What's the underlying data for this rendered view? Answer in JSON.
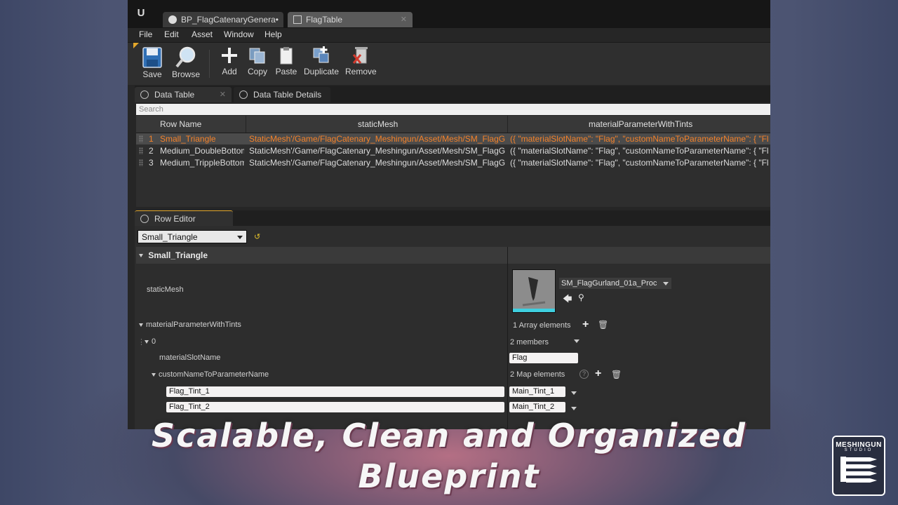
{
  "window": {
    "tabs": [
      {
        "label": "BP_FlagCatenaryGenera•"
      },
      {
        "label": "FlagTable"
      }
    ],
    "menu": [
      "File",
      "Edit",
      "Asset",
      "Window",
      "Help"
    ],
    "toolbar": {
      "save": "Save",
      "browse": "Browse",
      "add": "Add",
      "copy": "Copy",
      "paste": "Paste",
      "duplicate": "Duplicate",
      "remove": "Remove"
    },
    "panel_tabs": [
      "Data Table",
      "Data Table Details"
    ],
    "search_placeholder": "Search",
    "table": {
      "columns": [
        "Row Name",
        "staticMesh",
        "materialParameterWithTints"
      ],
      "rows": [
        {
          "num": "1",
          "name": "Small_Triangle",
          "mesh": "StaticMesh'/Game/FlagCatenary_Meshingun/Asset/Mesh/SM_FlagGurla",
          "params": "({ \"materialSlotName\": \"Flag\", \"customNameToParameterName\": { \"Flag_T"
        },
        {
          "num": "2",
          "name": "Medium_DoubleBottom",
          "mesh": "StaticMesh'/Game/FlagCatenary_Meshingun/Asset/Mesh/SM_FlagGurla",
          "params": "({ \"materialSlotName\": \"Flag\", \"customNameToParameterName\": { \"Flag_T"
        },
        {
          "num": "3",
          "name": "Medium_TrippleBottom",
          "mesh": "StaticMesh'/Game/FlagCatenary_Meshingun/Asset/Mesh/SM_FlagGurla",
          "params": "({ \"materialSlotName\": \"Flag\", \"customNameToParameterName\": { \"Flag_T"
        }
      ]
    },
    "row_editor": {
      "tab": "Row Editor",
      "selected_row": "Small_Triangle",
      "section": "Small_Triangle",
      "static_mesh_label": "staticMesh",
      "mesh_value": "SM_FlagGurland_01a_Proc",
      "mat_param_label": "materialParameterWithTints",
      "array_elements": "1 Array elements",
      "index_label": "0",
      "members": "2 members",
      "slot_label": "materialSlotName",
      "slot_value": "Flag",
      "map_label": "customNameToParameterName",
      "map_elements": "2 Map elements",
      "map": [
        {
          "key": "Flag_Tint_1",
          "value": "Main_Tint_1"
        },
        {
          "key": "Flag_Tint_2",
          "value": "Main_Tint_2"
        }
      ]
    }
  },
  "overlay": {
    "line1": "Scalable, Clean and Organized",
    "line2": "Blueprint"
  },
  "brand": {
    "name": "MESHINGUN",
    "sub": "STUDIO"
  },
  "colors": {
    "selected_row_text": "#f4822a",
    "accent_yellow": "#e3c12b"
  }
}
